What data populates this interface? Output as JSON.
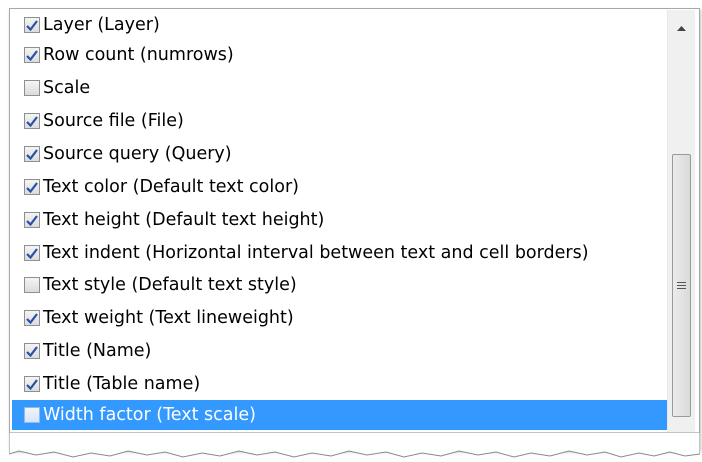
{
  "property_list": {
    "items": [
      {
        "label": "Layer (Layer)",
        "checked": true
      },
      {
        "label": "Row count (numrows)",
        "checked": true
      },
      {
        "label": "Scale",
        "checked": false
      },
      {
        "label": "Source file (File)",
        "checked": true
      },
      {
        "label": "Source query (Query)",
        "checked": true
      },
      {
        "label": "Text color (Default text color)",
        "checked": true
      },
      {
        "label": "Text height (Default text height)",
        "checked": true
      },
      {
        "label": "Text indent (Horizontal interval between text and cell borders)",
        "checked": true
      },
      {
        "label": "Text style (Default text style)",
        "checked": false
      },
      {
        "label": "Text weight (Text lineweight)",
        "checked": true
      },
      {
        "label": "Title (Name)",
        "checked": true
      },
      {
        "label": "Title (Table name)",
        "checked": true
      },
      {
        "label": "Width factor (Text scale)",
        "checked": false,
        "selected": true
      }
    ]
  },
  "colors": {
    "selection": "#3399ff",
    "checkmark": "#2a4fa8"
  },
  "icons": {
    "scroll_up": "chevron-up-icon",
    "scroll_down": "chevron-down-icon",
    "thumb_grip": "grip-icon"
  }
}
